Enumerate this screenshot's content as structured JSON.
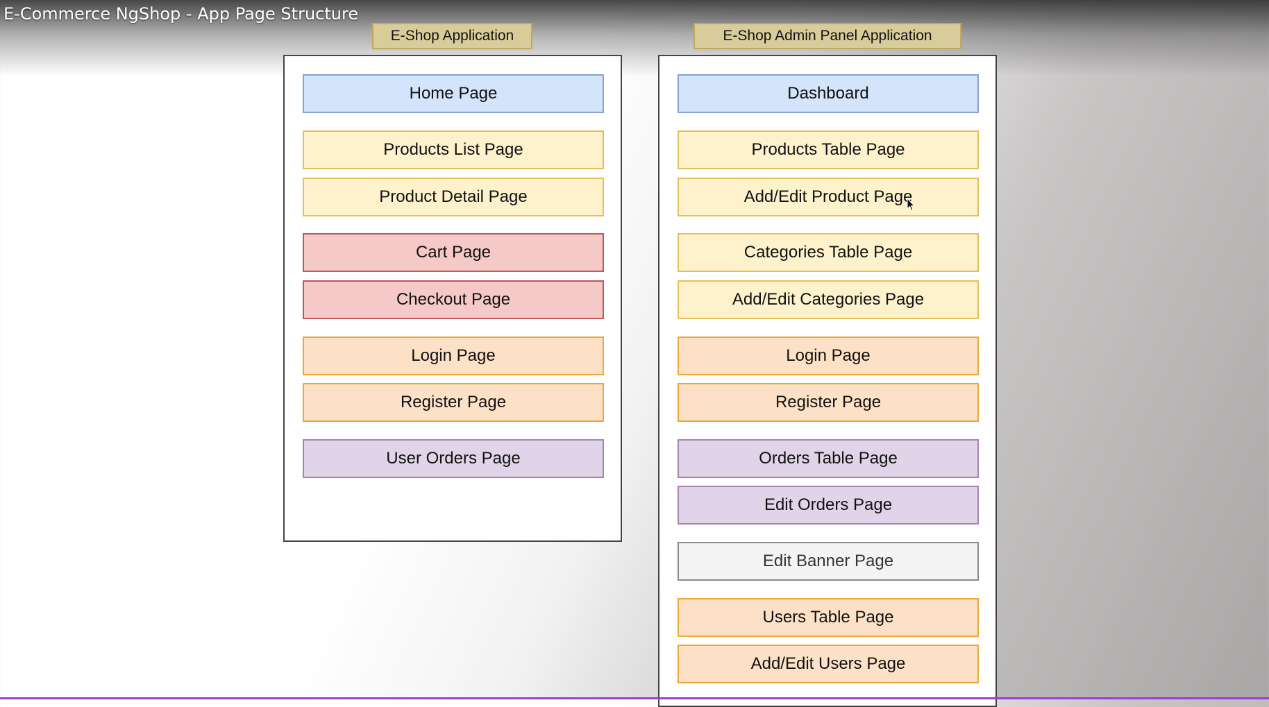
{
  "video": {
    "title": "E-Commerce NgShop - App Page Structure"
  },
  "eshop": {
    "label": "E-Shop Application",
    "pages": [
      {
        "label": "Home Page",
        "color": "blue"
      },
      {
        "label": "Products List Page",
        "color": "yellow"
      },
      {
        "label": "Product Detail Page",
        "color": "yellow"
      },
      {
        "label": "Cart Page",
        "color": "red"
      },
      {
        "label": "Checkout Page",
        "color": "red"
      },
      {
        "label": "Login Page",
        "color": "orange"
      },
      {
        "label": "Register Page",
        "color": "orange"
      },
      {
        "label": "User Orders Page",
        "color": "purple"
      }
    ]
  },
  "admin": {
    "label": "E-Shop Admin Panel Application",
    "pages": [
      {
        "label": "Dashboard",
        "color": "blue"
      },
      {
        "label": "Products Table Page",
        "color": "yellow"
      },
      {
        "label": "Add/Edit Product Page",
        "color": "yellow"
      },
      {
        "label": "Categories Table Page",
        "color": "yellow"
      },
      {
        "label": "Add/Edit Categories Page",
        "color": "yellow"
      },
      {
        "label": "Login Page",
        "color": "orange"
      },
      {
        "label": "Register Page",
        "color": "orange"
      },
      {
        "label": "Orders Table Page",
        "color": "purple"
      },
      {
        "label": "Edit Orders Page",
        "color": "purple"
      },
      {
        "label": "Edit Banner Page",
        "color": "grey"
      },
      {
        "label": "Users Table Page",
        "color": "orange"
      },
      {
        "label": "Add/Edit Users Page",
        "color": "orange"
      }
    ]
  },
  "colors": {
    "blue": "#d4e4fa",
    "yellow": "#fef2cd",
    "red": "#f6c9c9",
    "orange": "#fde1c6",
    "purple": "#e1d4e8",
    "grey": "#f4f4f4",
    "accent_line": "#9b3fd1"
  }
}
